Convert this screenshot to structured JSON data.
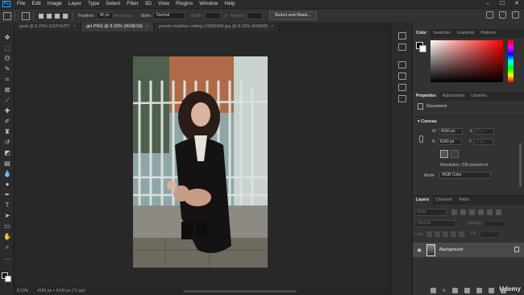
{
  "menubar": {
    "logo": "Ps",
    "items": [
      "File",
      "Edit",
      "Image",
      "Layer",
      "Type",
      "Select",
      "Filter",
      "3D",
      "View",
      "Plugins",
      "Window",
      "Help"
    ],
    "min": "–",
    "max": "☐",
    "close": "✕"
  },
  "options": {
    "feather_label": "Feather:",
    "feather_value": "40 px",
    "antialias_label": "Anti-alias",
    "style_label": "Style:",
    "style_value": "Normal",
    "width_label": "Width:",
    "height_label": "Height:",
    "select_mask": "Select and Mask..."
  },
  "tabs": [
    {
      "label": "goat @ 6.25% (CMYK/8*)",
      "close": "×"
    },
    {
      "label": "girl.PNG @ 8.33% (RGB/16)",
      "close": "×"
    },
    {
      "label": "pexels-mathias-reding-13356439.jpg @ 8.33% (RGB/8)",
      "close": "×"
    }
  ],
  "status": {
    "zoom": "8.33%",
    "doc": "4160 px × 6240 px (72 ppi)"
  },
  "color_panel": {
    "tabs": [
      "Color",
      "Swatches",
      "Gradients",
      "Patterns"
    ],
    "colors": {
      "foreground": "#000000",
      "background": "#ffffff"
    }
  },
  "properties": {
    "tabs": [
      "Properties",
      "Adjustments",
      "Libraries"
    ],
    "doc_label": "Document",
    "canvas_title": "Canvas",
    "w_label": "W",
    "w_value": "4160 px",
    "h_label": "H",
    "h_value": "6240 px",
    "x_label": "X",
    "x_value": "0 px",
    "y_label": "Y",
    "y_value": "0 px",
    "resolution": "Resolution: 238 pixels/inch",
    "mode_label": "Mode",
    "mode_value": "RGB Color"
  },
  "layers": {
    "tabs": [
      "Layers",
      "Channels",
      "Paths"
    ],
    "search_placeholder": "Kind",
    "blend_mode": "Normal",
    "opacity_label": "Opacity:",
    "lock_label": "Lock:",
    "fill_label": "Fill:",
    "layer_name": "Background",
    "fx_label": "fx"
  },
  "watermark": "Udemy"
}
